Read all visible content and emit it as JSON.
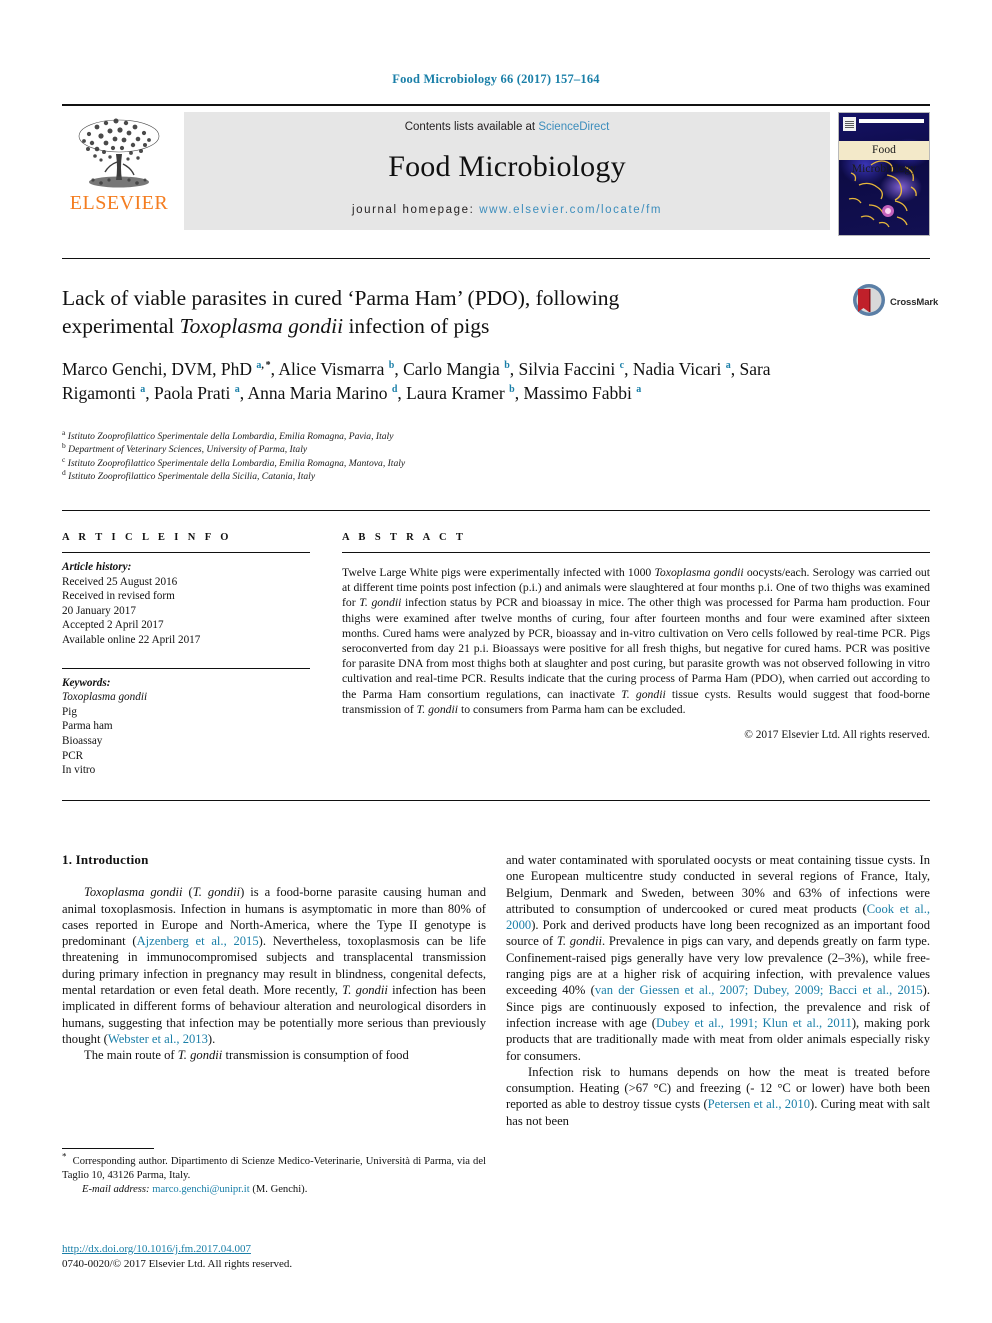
{
  "running_head": "Food Microbiology 66 (2017) 157–164",
  "masthead": {
    "publisher_name": "ELSEVIER",
    "contents_prefix": "Contents lists available at ",
    "contents_link": "ScienceDirect",
    "journal_title": "Food Microbiology",
    "homepage_label": "journal homepage: ",
    "homepage_url": "www.elsevier.com/locate/fm",
    "cover_title": "Food Microbiology",
    "accent_orange": "#f47d20",
    "link_blue": "#3c8dbc",
    "banner_grey": "#e6e6e6"
  },
  "crossmark": {
    "label": "CrossMark"
  },
  "article": {
    "title_line1": "Lack of viable parasites in cured ‘Parma Ham’ (PDO), following",
    "title_line2_pre": "experimental ",
    "title_line2_italic": "Toxoplasma gondii",
    "title_line2_post": " infection of pigs",
    "authors_html": "Marco Genchi, DVM, PhD <sup>a</sup><sup class=\"star\">, *</sup>, Alice Vismarra <sup>b</sup>, Carlo Mangia <sup>b</sup>, Silvia Faccini <sup>c</sup>, Nadia Vicari <sup>a</sup>, Sara Rigamonti <sup>a</sup>, Paola Prati <sup>a</sup>, Anna Maria Marino <sup>d</sup>, Laura Kramer <sup>b</sup>, Massimo Fabbi <sup>a</sup>",
    "affiliations": [
      {
        "marker": "a",
        "text": "Istituto Zooprofilattico Sperimentale della Lombardia, Emilia Romagna, Pavia, Italy"
      },
      {
        "marker": "b",
        "text": "Department of Veterinary Sciences, University of Parma, Italy"
      },
      {
        "marker": "c",
        "text": "Istituto Zooprofilattico Sperimentale della Lombardia, Emilia Romagna, Mantova, Italy"
      },
      {
        "marker": "d",
        "text": "Istituto Zooprofilattico Sperimentale della Sicilia, Catania, Italy"
      }
    ]
  },
  "article_info": {
    "heading": "A R T I C L E   I N F O",
    "history_label": "Article history:",
    "history": [
      "Received 25 August 2016",
      "Received in revised form",
      "20 January 2017",
      "Accepted 2 April 2017",
      "Available online 22 April 2017"
    ],
    "keywords_label": "Keywords:",
    "keywords": [
      "Toxoplasma gondii",
      "Pig",
      "Parma ham",
      "Bioassay",
      "PCR",
      "In vitro"
    ]
  },
  "abstract": {
    "heading": "A B S T R A C T",
    "text_html": "Twelve Large White pigs were experimentally infected with 1000 <i>Toxoplasma gondii</i> oocysts/each. Serology was carried out at different time points post infection (p.i.) and animals were slaughtered at four months p.i. One of two thighs was examined for <i>T. gondii</i> infection status by PCR and bioassay in mice. The other thigh was processed for Parma ham production. Four thighs were examined after twelve months of curing, four after fourteen months and four were examined after sixteen months. Cured hams were analyzed by PCR, bioassay and in-vitro cultivation on Vero cells followed by real-time PCR. Pigs seroconverted from day 21 p.i. Bioassays were positive for all fresh thighs, but negative for cured hams. PCR was positive for parasite DNA from most thighs both at slaughter and post curing, but parasite growth was not observed following in vitro cultivation and real-time PCR. Results indicate that the curing process of Parma Ham (PDO), when carried out according to the Parma Ham consortium regulations, can inactivate <i>T. gondii</i> tissue cysts. Results would suggest that food-borne transmission of <i>T. gondii</i> to consumers from Parma ham can be excluded.",
    "copyright": "© 2017 Elsevier Ltd. All rights reserved."
  },
  "introduction": {
    "heading": "1. Introduction",
    "left_paragraphs_html": [
      "<i>Toxoplasma gondii</i> (<i>T. gondii</i>) is a food-borne parasite causing human and animal toxoplasmosis. Infection in humans is asymptomatic in more than 80% of cases reported in Europe and North-America, where the Type II genotype is predominant (<span class=\"ref\">Ajzenberg et al., 2015</span>). Nevertheless, toxoplasmosis can be life threatening in immunocompromised subjects and transplacental transmission during primary infection in pregnancy may result in blindness, congenital defects, mental retardation or even fetal death. More recently, <i>T. gondii</i> infection has been implicated in different forms of behaviour alteration and neurological disorders in humans, suggesting that infection may be potentially more serious than previously thought (<span class=\"ref\">Webster et al., 2013</span>).",
      "The main route of <i>T. gondii</i> transmission is consumption of food"
    ],
    "right_paragraphs_html": [
      "and water contaminated with sporulated oocysts or meat containing tissue cysts. In one European multicentre study conducted in several regions of France, Italy, Belgium, Denmark and Sweden, between 30% and 63% of infections were attributed to consumption of undercooked or cured meat products (<span class=\"ref\">Cook et al., 2000</span>). Pork and derived products have long been recognized as an important food source of <i>T. gondii</i>. Prevalence in pigs can vary, and depends greatly on farm type. Confinement-raised pigs generally have very low prevalence (2–3%), while free-ranging pigs are at a higher risk of acquiring infection, with prevalence values exceeding 40% (<span class=\"ref\">van der Giessen et al., 2007; Dubey, 2009; Bacci et al., 2015</span>). Since pigs are continuously exposed to infection, the prevalence and risk of infection increase with age (<span class=\"ref\">Dubey et al., 1991; Klun et al., 2011</span>), making pork products that are traditionally made with meat from older animals especially risky for consumers.",
      "Infection risk to humans depends on how the meat is treated before consumption. Heating (&gt;67 °C) and freezing (- 12 °C or lower) have both been reported as able to destroy tissue cysts (<span class=\"ref\">Petersen et al., 2010</span>). Curing meat with salt has not been"
    ]
  },
  "footnote": {
    "corresponding_html": "<span class=\"star\">*</span>&nbsp; Corresponding author. Dipartimento di Scienze Medico-Veterinarie, Università di Parma, via del Taglio 10, 43126 Parma, Italy.",
    "email_label": "E-mail address:",
    "email": "marco.genchi@unipr.it",
    "email_suffix": "(M. Genchi)."
  },
  "footer": {
    "doi": "http://dx.doi.org/10.1016/j.fm.2017.04.007",
    "issn_line": "0740-0020/© 2017 Elsevier Ltd. All rights reserved."
  }
}
